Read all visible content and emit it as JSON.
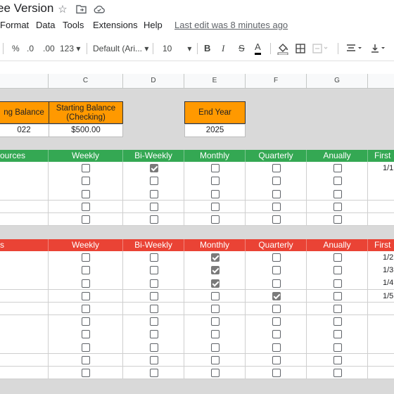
{
  "doc": {
    "title": "ee Version"
  },
  "menu": {
    "items": [
      "Format",
      "Data",
      "Tools",
      "Extensions",
      "Help"
    ],
    "last_edit": "Last edit was 8 minutes ago"
  },
  "toolbar": {
    "percent": "%",
    "dec_less": ".0",
    "dec_more": ".00",
    "number_format": "123",
    "font": "Default (Ari...",
    "font_size": "10",
    "bold": "B",
    "italic": "I",
    "strike": "S",
    "text_color": "A"
  },
  "columns": [
    "C",
    "D",
    "E",
    "F",
    "G"
  ],
  "balances": {
    "starting_label": "ng Balance",
    "starting_year": "022",
    "checking_label": "Starting Balance (Checking)",
    "checking_value": "$500.00",
    "end_year_label": "End Year",
    "end_year_value": "2025"
  },
  "income": {
    "header": "ources",
    "columns": [
      "Weekly",
      "Bi-Weekly",
      "Monthly",
      "Quarterly",
      "Anually",
      "First"
    ],
    "rows": [
      {
        "checks": [
          false,
          true,
          false,
          false,
          false
        ],
        "date": "1/1"
      },
      {
        "checks": [
          false,
          false,
          false,
          false,
          false
        ],
        "date": ""
      },
      {
        "checks": [
          false,
          false,
          false,
          false,
          false
        ],
        "date": ""
      },
      {
        "checks": [
          false,
          false,
          false,
          false,
          false
        ],
        "date": ""
      },
      {
        "checks": [
          false,
          false,
          false,
          false,
          false
        ],
        "date": ""
      }
    ]
  },
  "expenses": {
    "header": "s",
    "columns": [
      "Weekly",
      "Bi-Weekly",
      "Monthly",
      "Quarterly",
      "Anually",
      "First"
    ],
    "rows": [
      {
        "checks": [
          false,
          false,
          true,
          false,
          false
        ],
        "date": "1/2"
      },
      {
        "checks": [
          false,
          false,
          true,
          false,
          false
        ],
        "date": "1/3"
      },
      {
        "checks": [
          false,
          false,
          true,
          false,
          false
        ],
        "date": "1/4"
      },
      {
        "checks": [
          false,
          false,
          false,
          true,
          false
        ],
        "date": "1/5"
      },
      {
        "checks": [
          false,
          false,
          false,
          false,
          false
        ],
        "date": ""
      },
      {
        "checks": [
          false,
          false,
          false,
          false,
          false
        ],
        "date": ""
      },
      {
        "checks": [
          false,
          false,
          false,
          false,
          false
        ],
        "date": ""
      },
      {
        "checks": [
          false,
          false,
          false,
          false,
          false
        ],
        "date": ""
      },
      {
        "checks": [
          false,
          false,
          false,
          false,
          false
        ],
        "date": ""
      },
      {
        "checks": [
          false,
          false,
          false,
          false,
          false
        ],
        "date": ""
      }
    ]
  },
  "colors": {
    "orange": "#ff9900",
    "green": "#34a853",
    "red": "#ea4335"
  }
}
